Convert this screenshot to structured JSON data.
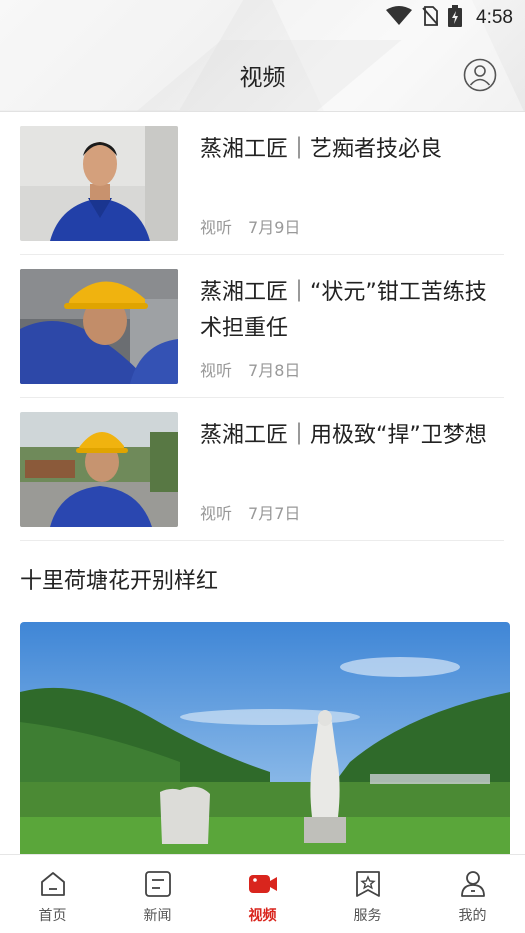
{
  "status_bar": {
    "time": "4:58",
    "icons": [
      "wifi-icon",
      "no-sim-icon",
      "battery-charging-icon"
    ]
  },
  "header": {
    "title": "视频",
    "profile_icon": "user-circle-icon"
  },
  "news": [
    {
      "title": "蒸湘工匠｜艺痴者技必良",
      "source": "视听",
      "date": "7月9日"
    },
    {
      "title": "蒸湘工匠｜“状元”钳工苦练技术担重任",
      "source": "视听",
      "date": "7月8日"
    },
    {
      "title": "蒸湘工匠｜用极致“捍”卫梦想",
      "source": "视听",
      "date": "7月7日"
    }
  ],
  "section": {
    "title": "十里荷塘花开别样红"
  },
  "bottom_nav": [
    {
      "label": "首页",
      "icon": "home-icon",
      "active": false
    },
    {
      "label": "新闻",
      "icon": "news-icon",
      "active": false
    },
    {
      "label": "视频",
      "icon": "video-icon",
      "active": true
    },
    {
      "label": "服务",
      "icon": "service-icon",
      "active": false
    },
    {
      "label": "我的",
      "icon": "profile-icon",
      "active": false
    }
  ],
  "colors": {
    "accent": "#d9251d",
    "meta_text": "#999999",
    "divider": "#ececec"
  }
}
